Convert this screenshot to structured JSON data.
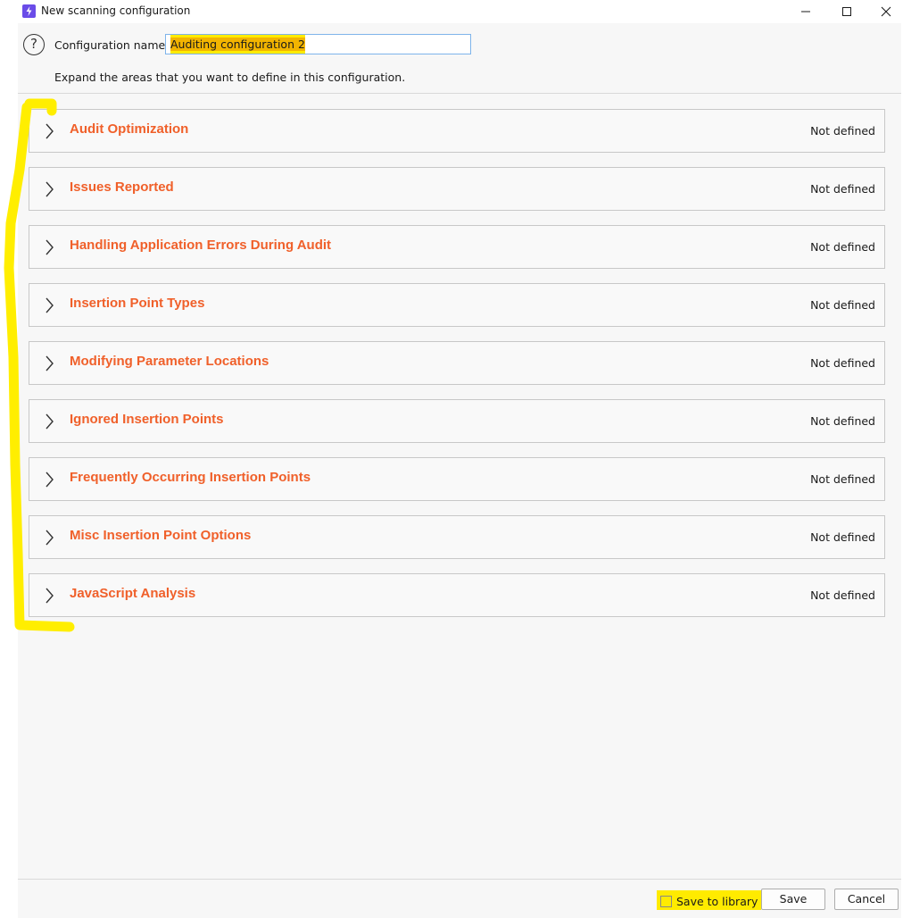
{
  "window": {
    "title": "New scanning configuration",
    "app_icon": "burp-lightning-icon",
    "controls": [
      "minimize",
      "maximize",
      "close"
    ]
  },
  "header": {
    "help_icon": "question-circle-icon",
    "config_label": "Configuration name:",
    "config_value": "Auditing configuration 2",
    "instructions": "Expand the areas that you want to define in this configuration."
  },
  "sections": [
    {
      "title": "Audit Optimization",
      "status": "Not defined"
    },
    {
      "title": "Issues Reported",
      "status": "Not defined"
    },
    {
      "title": "Handling Application Errors During Audit",
      "status": "Not defined"
    },
    {
      "title": "Insertion Point Types",
      "status": "Not defined"
    },
    {
      "title": "Modifying Parameter Locations",
      "status": "Not defined"
    },
    {
      "title": "Ignored Insertion Points",
      "status": "Not defined"
    },
    {
      "title": "Frequently Occurring Insertion Points",
      "status": "Not defined"
    },
    {
      "title": "Misc Insertion Point Options",
      "status": "Not defined"
    },
    {
      "title": "JavaScript Analysis",
      "status": "Not defined"
    }
  ],
  "footer": {
    "save_to_library_label": "Save to library",
    "save_to_library_checked": false,
    "save_label": "Save",
    "cancel_label": "Cancel"
  },
  "colors": {
    "section_title": "#f0602a",
    "highlight": "#ffeb00",
    "accent_icon": "#6a4ce8"
  }
}
